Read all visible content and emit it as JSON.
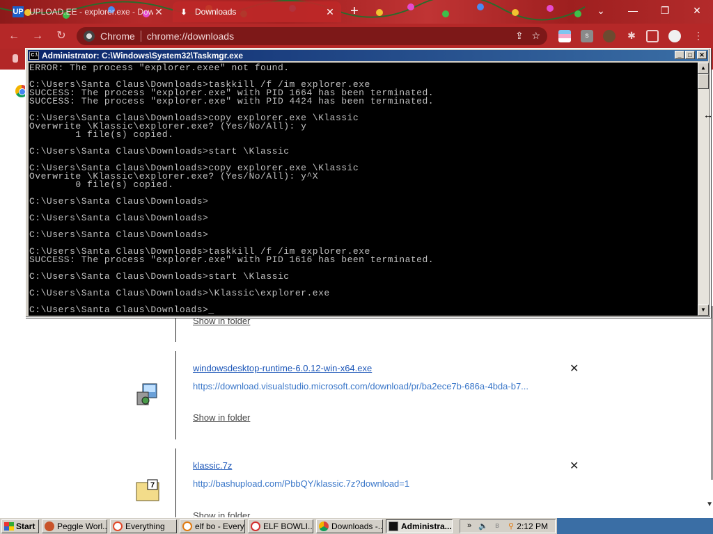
{
  "browser": {
    "tabs": [
      {
        "label": "UPLOAD.EE - explorer.exe - Down",
        "active": false,
        "icon": "upload-ee-icon"
      },
      {
        "label": "Downloads",
        "active": true,
        "icon": "download-icon"
      }
    ],
    "new_tab": "+",
    "omnibox": {
      "site_chip": "Chrome",
      "url": "chrome://downloads"
    }
  },
  "cmd": {
    "title": "Administrator: C:\\Windows\\System32\\Taskmgr.exe",
    "lines": [
      "ERROR: The process \"explorer.exee\" not found.",
      "",
      "C:\\Users\\Santa Claus\\Downloads>taskkill /f /im explorer.exe",
      "SUCCESS: The process \"explorer.exe\" with PID 1664 has been terminated.",
      "SUCCESS: The process \"explorer.exe\" with PID 4424 has been terminated.",
      "",
      "C:\\Users\\Santa Claus\\Downloads>copy explorer.exe \\Klassic",
      "Overwrite \\Klassic\\explorer.exe? (Yes/No/All): y",
      "        1 file(s) copied.",
      "",
      "C:\\Users\\Santa Claus\\Downloads>start \\Klassic",
      "",
      "C:\\Users\\Santa Claus\\Downloads>copy explorer.exe \\Klassic",
      "Overwrite \\Klassic\\explorer.exe? (Yes/No/All): y^X",
      "        0 file(s) copied.",
      "",
      "C:\\Users\\Santa Claus\\Downloads>",
      "",
      "C:\\Users\\Santa Claus\\Downloads>",
      "",
      "C:\\Users\\Santa Claus\\Downloads>",
      "",
      "C:\\Users\\Santa Claus\\Downloads>taskkill /f /im explorer.exe",
      "SUCCESS: The process \"explorer.exe\" with PID 1616 has been terminated.",
      "",
      "C:\\Users\\Santa Claus\\Downloads>start \\Klassic",
      "",
      "C:\\Users\\Santa Claus\\Downloads>\\Klassic\\explorer.exe",
      "",
      "C:\\Users\\Santa Claus\\Downloads>_"
    ]
  },
  "downloads": {
    "items": [
      {
        "name": "",
        "url": "",
        "show_in_folder": "Show in folder"
      },
      {
        "name": "windowsdesktop-runtime-6.0.12-win-x64.exe",
        "url": "https://download.visualstudio.microsoft.com/download/pr/ba2ece7b-686a-4bda-b7...",
        "show_in_folder": "Show in folder",
        "icon": "installer-icon"
      },
      {
        "name": "klassic.7z",
        "url": "http://bashupload.com/PbbQY/klassic.7z?download=1",
        "show_in_folder": "Show in folder",
        "icon": "7z-archive-icon"
      }
    ],
    "remove_glyph": "✕"
  },
  "taskbar": {
    "start": "Start",
    "tasks": [
      {
        "label": "Peggle Worl...",
        "icon_color": "#c8542a"
      },
      {
        "label": "Everything",
        "icon_color": "#e24a2a"
      },
      {
        "label": "elf bo - Every...",
        "icon_color": "#e07a10"
      },
      {
        "label": "ELF BOWLI...",
        "icon_color": "#d23030"
      },
      {
        "label": "Downloads -...",
        "icon_color": "#4a8ad4"
      },
      {
        "label": "Administra...",
        "icon_color": "#111111",
        "pressed": true
      }
    ],
    "tray_chevron": "»",
    "clock": "2:12 PM"
  }
}
